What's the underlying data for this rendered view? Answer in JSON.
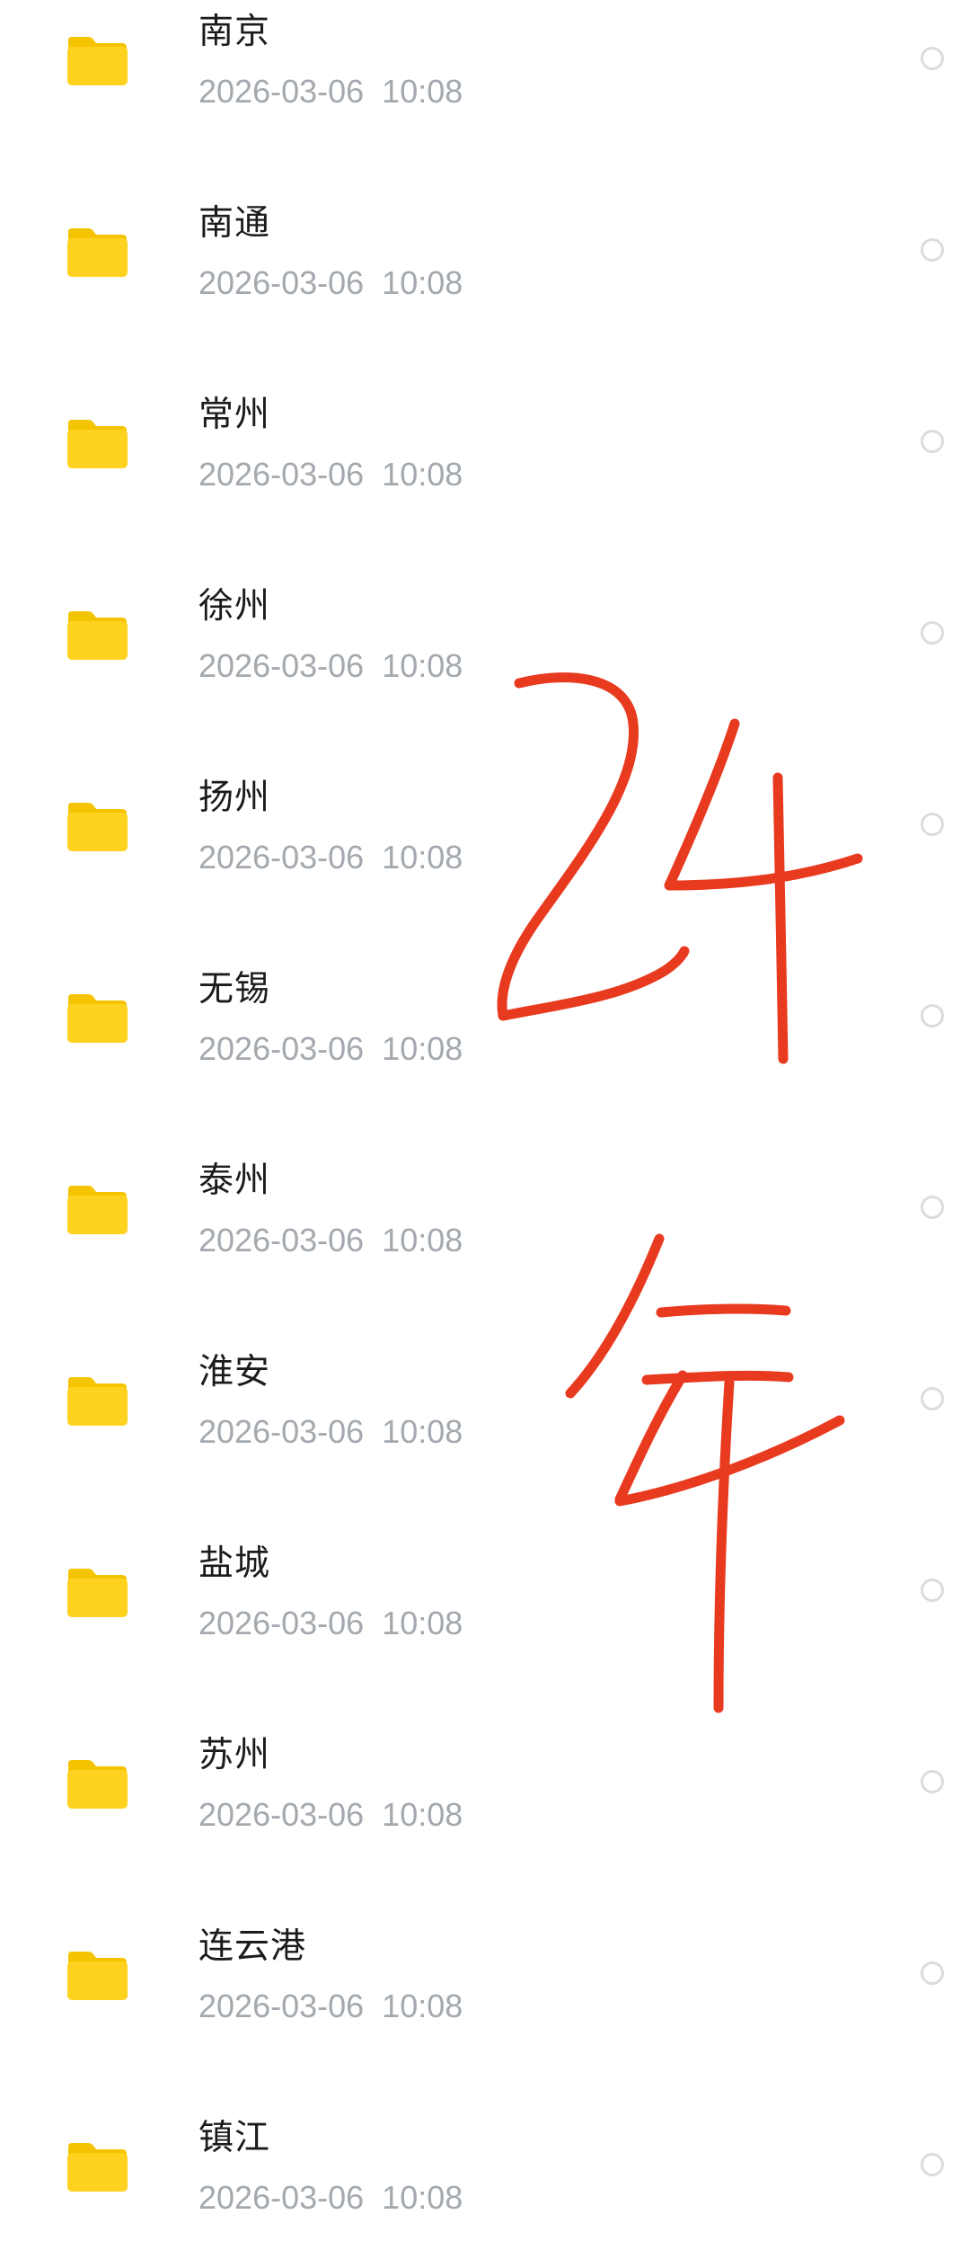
{
  "file_list": {
    "items": [
      {
        "name": "南京",
        "date": "2026-03-06",
        "time": "10:08",
        "icon": "folder-icon"
      },
      {
        "name": "南通",
        "date": "2026-03-06",
        "time": "10:08",
        "icon": "folder-icon"
      },
      {
        "name": "常州",
        "date": "2026-03-06",
        "time": "10:08",
        "icon": "folder-icon"
      },
      {
        "name": "徐州",
        "date": "2026-03-06",
        "time": "10:08",
        "icon": "folder-icon"
      },
      {
        "name": "扬州",
        "date": "2026-03-06",
        "time": "10:08",
        "icon": "folder-icon"
      },
      {
        "name": "无锡",
        "date": "2026-03-06",
        "time": "10:08",
        "icon": "folder-icon"
      },
      {
        "name": "泰州",
        "date": "2026-03-06",
        "time": "10:08",
        "icon": "folder-icon"
      },
      {
        "name": "淮安",
        "date": "2026-03-06",
        "time": "10:08",
        "icon": "folder-icon"
      },
      {
        "name": "盐城",
        "date": "2026-03-06",
        "time": "10:08",
        "icon": "folder-icon"
      },
      {
        "name": "苏州",
        "date": "2026-03-06",
        "time": "10:08",
        "icon": "folder-icon"
      },
      {
        "name": "连云港",
        "date": "2026-03-06",
        "time": "10:08",
        "icon": "folder-icon"
      },
      {
        "name": "镇江",
        "date": "2026-03-06",
        "time": "10:08",
        "icon": "folder-icon"
      }
    ]
  },
  "annotation": {
    "text": "24年",
    "color": "#e83a1f"
  },
  "colors": {
    "folder": "#ffd21f",
    "folder_tab": "#f5c400",
    "name_text": "#1b1b1b",
    "meta_text": "#a3a9ae",
    "radio_border": "#dcdcdc"
  }
}
